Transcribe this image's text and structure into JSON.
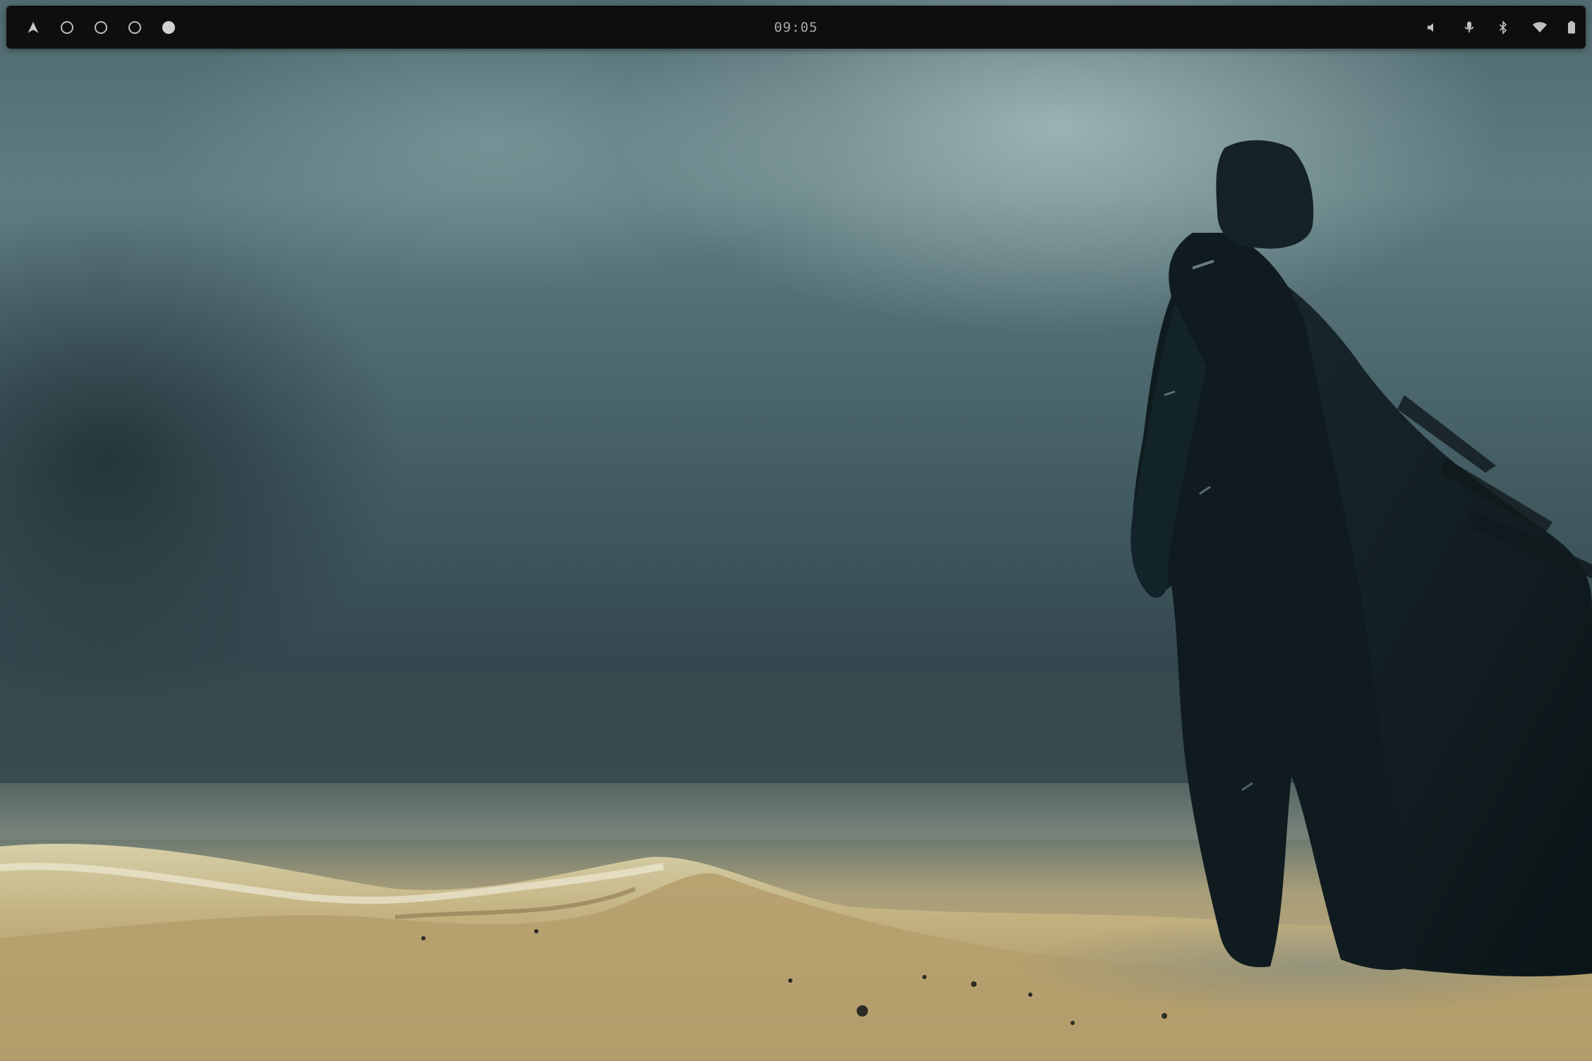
{
  "topbar": {
    "launcher_icon": "arch-logo-icon",
    "workspaces": [
      {
        "state": "inactive"
      },
      {
        "state": "inactive"
      },
      {
        "state": "inactive"
      },
      {
        "state": "active"
      }
    ],
    "clock": "09:05",
    "tray_icons": [
      "volume-icon",
      "microphone-icon",
      "bluetooth-icon",
      "wifi-icon",
      "battery-icon"
    ]
  },
  "colors": {
    "bar_background": "#0e0e0e",
    "icon_color": "#bdbdbd",
    "sky": "#4f6a70",
    "sand": "#b9a77a",
    "figure": "#0f1a1e"
  },
  "wallpaper": {
    "subject": "cloaked-wanderer-in-desert-storm"
  }
}
